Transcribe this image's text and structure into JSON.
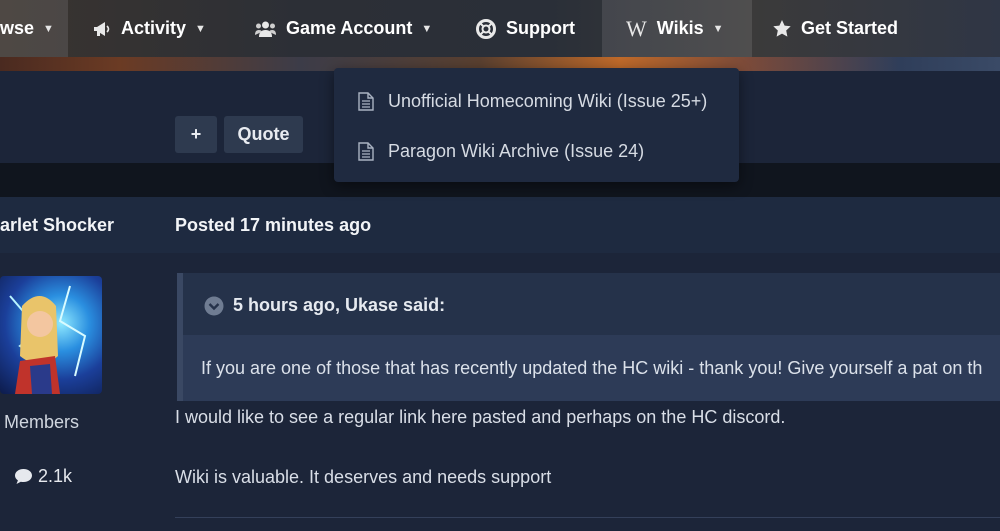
{
  "nav": {
    "items": [
      {
        "label": "wse",
        "icon": "browse-icon"
      },
      {
        "label": "Activity",
        "icon": "megaphone-icon"
      },
      {
        "label": "Game Account",
        "icon": "users-icon"
      },
      {
        "label": "Support",
        "icon": "lifebuoy-icon"
      },
      {
        "label": "Wikis",
        "icon": "wikipedia-icon"
      },
      {
        "label": "Get Started",
        "icon": "star-icon"
      }
    ]
  },
  "dropdown": {
    "items": [
      {
        "label": "Unofficial Homecoming Wiki (Issue 25+)"
      },
      {
        "label": "Paragon Wiki Archive (Issue 24)"
      }
    ]
  },
  "toolbar": {
    "plus_label": "+",
    "quote_label": "Quote"
  },
  "post": {
    "author": "arlet Shocker",
    "posted_prefix": "Posted",
    "posted_time": "17 minutes ago",
    "member_group": "Members",
    "post_count": "2.1k",
    "quote": {
      "cite": "5 hours ago, Ukase said:",
      "text": "If you are one of those that has recently updated the HC wiki - thank you! Give yourself a pat on th"
    },
    "paragraphs": [
      "I would like to see a regular link here pasted and perhaps on the HC discord.",
      "Wiki is valuable. It deserves and needs support"
    ]
  },
  "colors": {
    "background": "#1b2438",
    "nav_text": "#ffffff",
    "quote_border": "#3a4863"
  }
}
